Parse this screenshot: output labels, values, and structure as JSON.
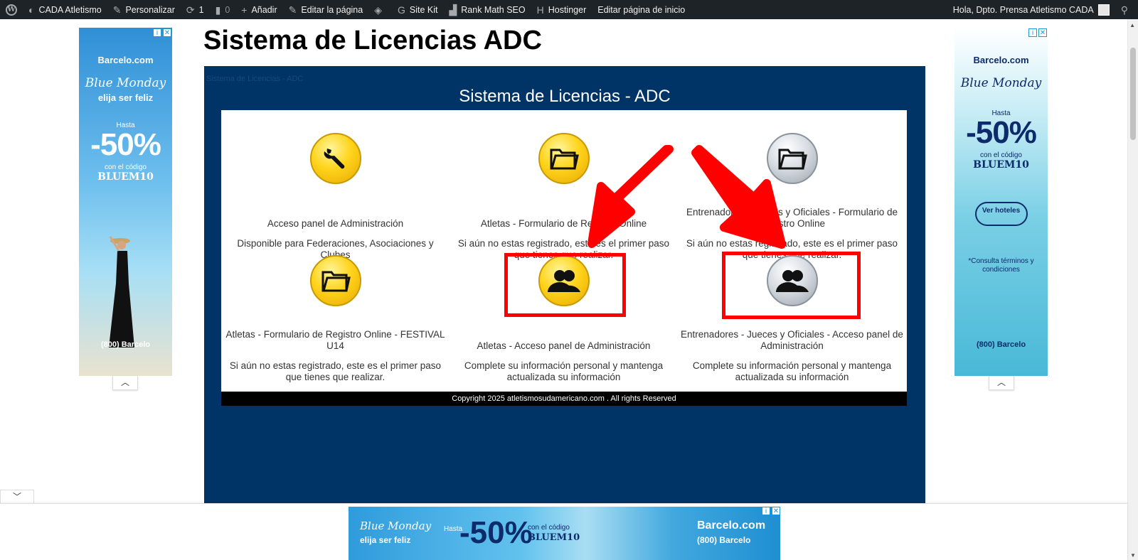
{
  "admin_bar": {
    "site_name": "CADA Atletismo",
    "customize": "Personalizar",
    "updates_count": "1",
    "comments_count": "0",
    "add_new": "Añadir",
    "edit_page": "Editar la página",
    "site_kit": "Site Kit",
    "rank_math": "Rank Math SEO",
    "hostinger": "Hostinger",
    "edit_home": "Editar página de inicio",
    "greeting": "Hola, Dpto. Prensa Atletismo CADA"
  },
  "page": {
    "title": "Sistema de Licencias ADC",
    "breadcrumb_faint": "Sistema de Licencias - ADC",
    "heading": "Sistema de Licencias - ADC",
    "copyright": "Copyright 2025 atletismosudamericano.com . All rights Reserved"
  },
  "tiles": [
    {
      "icon": "wrench-icon",
      "color": "#ffd41c",
      "title": "Acceso panel de Administración",
      "desc": "Disponible para Federaciones, Asociaciones y Clubes"
    },
    {
      "icon": "folder-icon",
      "color": "#ffd41c",
      "title": "Atletas - Formulario de Registro Online",
      "desc": "Si aún no estas registrado, este es el primer paso que tienes que realizar."
    },
    {
      "icon": "folder-icon",
      "color": "#d8dde3",
      "title": "Entrenadores - Jueces y Oficiales - Formulario de Registro Online",
      "desc": "Si aún no estas registrado, este es el primer paso que tienes que realizar."
    },
    {
      "icon": "folder-icon",
      "color": "#ffd41c",
      "title": "Atletas - Formulario de Registro Online - FESTIVAL U14",
      "desc": "Si aún no estas registrado, este es el primer paso que tienes que realizar."
    },
    {
      "icon": "users-icon",
      "color": "#ffd41c",
      "title": "Atletas - Acceso panel de Administración",
      "desc": "Complete su información personal y mantenga actualizada su información"
    },
    {
      "icon": "users-icon",
      "color": "#d8dde3",
      "title": "Entrenadores - Jueces y Oficiales - Acceso panel de Administración",
      "desc": "Complete su información personal y mantenga actualizada su información"
    }
  ],
  "ads": {
    "left": {
      "brand": "Barcelo.com",
      "script": "Blue Monday",
      "tagline": "elija ser feliz",
      "hasta": "Hasta",
      "discount": "-50%",
      "code_label": "con el código",
      "code": "BLUEM10",
      "footer": "(800) Barcelo"
    },
    "right": {
      "brand": "Barcelo.com",
      "script": "Blue Monday",
      "hasta": "Hasta",
      "discount": "-50%",
      "code_label": "con el código",
      "code": "BLUEM10",
      "cta": "Ver hoteles",
      "terms": "*Consulta términos y condiciones",
      "footer": "(800) Barcelo"
    },
    "bottom": {
      "script": "Blue Monday",
      "tagline": "elija ser feliz",
      "hasta": "Hasta",
      "discount": "-50%",
      "code_label": "con el código",
      "code": "BLUEM10",
      "brand": "Barcelo.com",
      "phone": "(800) Barcelo"
    }
  },
  "annotation_color": "#ff0000"
}
